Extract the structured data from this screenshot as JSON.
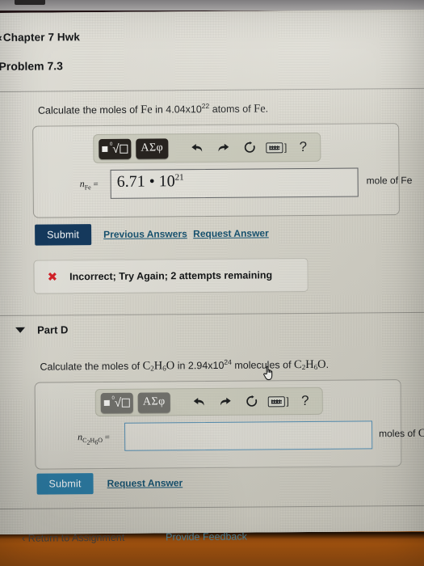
{
  "browser": {
    "tab_strip_visible": true
  },
  "breadcrumb": {
    "chevron": "‹",
    "label": "Chapter 7 Hwk"
  },
  "problem": {
    "title": "Problem 7.3"
  },
  "part_c": {
    "question_prefix": "Calculate the moles of ",
    "question_sym1": "Fe",
    "question_mid": " in 4.04x10",
    "question_exp": "22",
    "question_mid2": " atoms of ",
    "question_sym2": "Fe",
    "question_end": ".",
    "toolbar": {
      "template_button": "template-root",
      "greek_button": "ΑΣφ",
      "undo": "↶",
      "redo": "↷",
      "reset": "↺",
      "keyboard": "keyboard",
      "keyboard_bracket": "]",
      "help": "?"
    },
    "var_label_n": "n",
    "var_label_sub": "Fe",
    "var_label_eq": " =",
    "answer_mantissa": "6.71 • 10",
    "answer_exponent": "21",
    "unit": "mole of Fe",
    "submit_label": "Submit",
    "previous_answers_label": "Previous Answers",
    "request_answer_label": "Request Answer",
    "feedback_icon": "✖",
    "feedback_text": "Incorrect; Try Again; 2 attempts remaining",
    "feedback_color": "#cf2027",
    "submit_color": "#15395c"
  },
  "part_d": {
    "header_label": "Part D",
    "expanded": true,
    "question_prefix": "Calculate the moles of ",
    "question_sym1_c": "C",
    "question_sym1_c_sub": "2",
    "question_sym1_h": "H",
    "question_sym1_h_sub": "6",
    "question_sym1_o": "O",
    "question_mid": " in 2.94x10",
    "question_exp": "24",
    "question_mid2": " molecules of ",
    "question_end": ".",
    "toolbar": {
      "template_button": "template-root",
      "greek_button": "ΑΣφ",
      "undo": "↶",
      "redo": "↷",
      "reset": "↺",
      "keyboard": "keyboard",
      "keyboard_bracket": "]",
      "help": "?"
    },
    "var_label_n": "n",
    "var_label_eq": " =",
    "answer_value": "",
    "answer_placeholder": "",
    "unit_prefix": "moles of ",
    "submit_label": "Submit",
    "request_answer_label": "Request Answer",
    "submit_color": "#2c7ba3",
    "input_focus_color": "#4f86a8"
  },
  "footer": {
    "return_chevron": "‹",
    "return_label": "Return to Assignment",
    "feedback_label": "Provide Feedback"
  },
  "cursor": {
    "type": "pointing-hand"
  }
}
